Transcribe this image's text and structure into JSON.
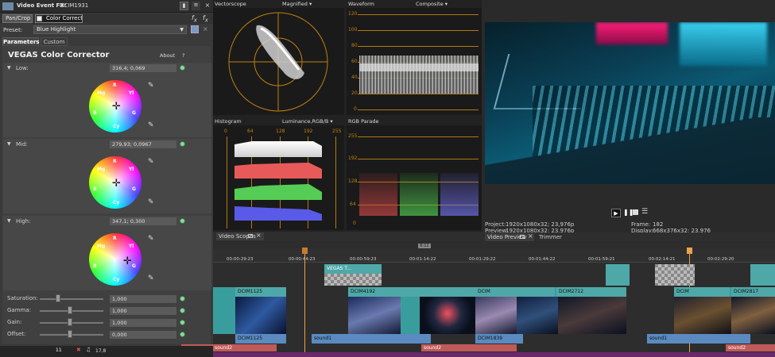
{
  "fx": {
    "title": "Video Event FX:",
    "event": "DCIM1931",
    "chain": [
      "Pan/Crop",
      "Color Corrector"
    ],
    "preset_label": "Preset:",
    "preset_value": "Blue Highlight",
    "tabs": [
      "Parameters",
      "Custom"
    ],
    "plugin_name": "VEGAS Color Corrector",
    "about": "About",
    "help": "?",
    "low": {
      "label": "Low:",
      "value": "316,4; 0,069"
    },
    "mid": {
      "label": "Mid:",
      "value": "279,93; 0,0967"
    },
    "high": {
      "label": "High:",
      "value": "347,1; 0,300"
    },
    "sliders": [
      {
        "label": "Saturation:",
        "value": "1,000",
        "level": 0.29
      },
      {
        "label": "Gamma:",
        "value": "1,000",
        "level": 0.48
      },
      {
        "label": "Gain:",
        "value": "1,000",
        "level": 0.48
      },
      {
        "label": "Offset:",
        "value": "0,000",
        "level": 0.48
      }
    ],
    "wheel_letters": [
      "R",
      "Mg",
      "B",
      "Cy",
      "G",
      "Yl"
    ]
  },
  "scopes": {
    "vectorscope": {
      "title": "Vectorscope",
      "mode": "Magnified"
    },
    "waveform": {
      "title": "Waveform",
      "mode": "Composite",
      "ticks": [
        "120",
        "100",
        "80",
        "60",
        "40",
        "20",
        "0"
      ]
    },
    "histogram": {
      "title": "Histogram",
      "mode": "Luminance,RGB/B",
      "ticks": [
        "0",
        "64",
        "128",
        "192",
        "255"
      ]
    },
    "parade": {
      "title": "RGB Parade",
      "ticks": [
        "255",
        "192",
        "128",
        "64",
        "0"
      ]
    },
    "dock_tab": "Video Scopes"
  },
  "preview": {
    "project_label": "Project:",
    "project_value": "1920x1080x32; 23,976p",
    "preview_label": "Preview:",
    "preview_value": "1920x1080x32; 23,976p",
    "frame_label": "Frame:",
    "frame_value": "182",
    "display_label": "Display:",
    "display_value": "668x376x32; 23,976",
    "tabs": [
      "Video Preview",
      "Trimmer"
    ]
  },
  "timeline": {
    "marker": "6:12",
    "ruler": [
      "00:00:29:23",
      "00:00:44:23",
      "00:00:59:23",
      "00:01:14:22",
      "00:01:29:22",
      "00:01:44:22",
      "00:01:59:21",
      "00:02:14:21",
      "00:02:29:20"
    ],
    "top_clips": [
      "VEGAS T..."
    ],
    "video_clips": [
      "DCIM1125",
      "DCIM4192",
      "DCIM",
      "DCIM2712",
      "DCIM",
      "DCIM2817"
    ],
    "audio_clips": [
      "DCIM1125",
      "sound1",
      "DCIM1839",
      "sound1"
    ],
    "bottom_clips": [
      "sound2",
      "sound2",
      "sound2"
    ],
    "track_numbers": [
      "11",
      "17,8"
    ]
  }
}
